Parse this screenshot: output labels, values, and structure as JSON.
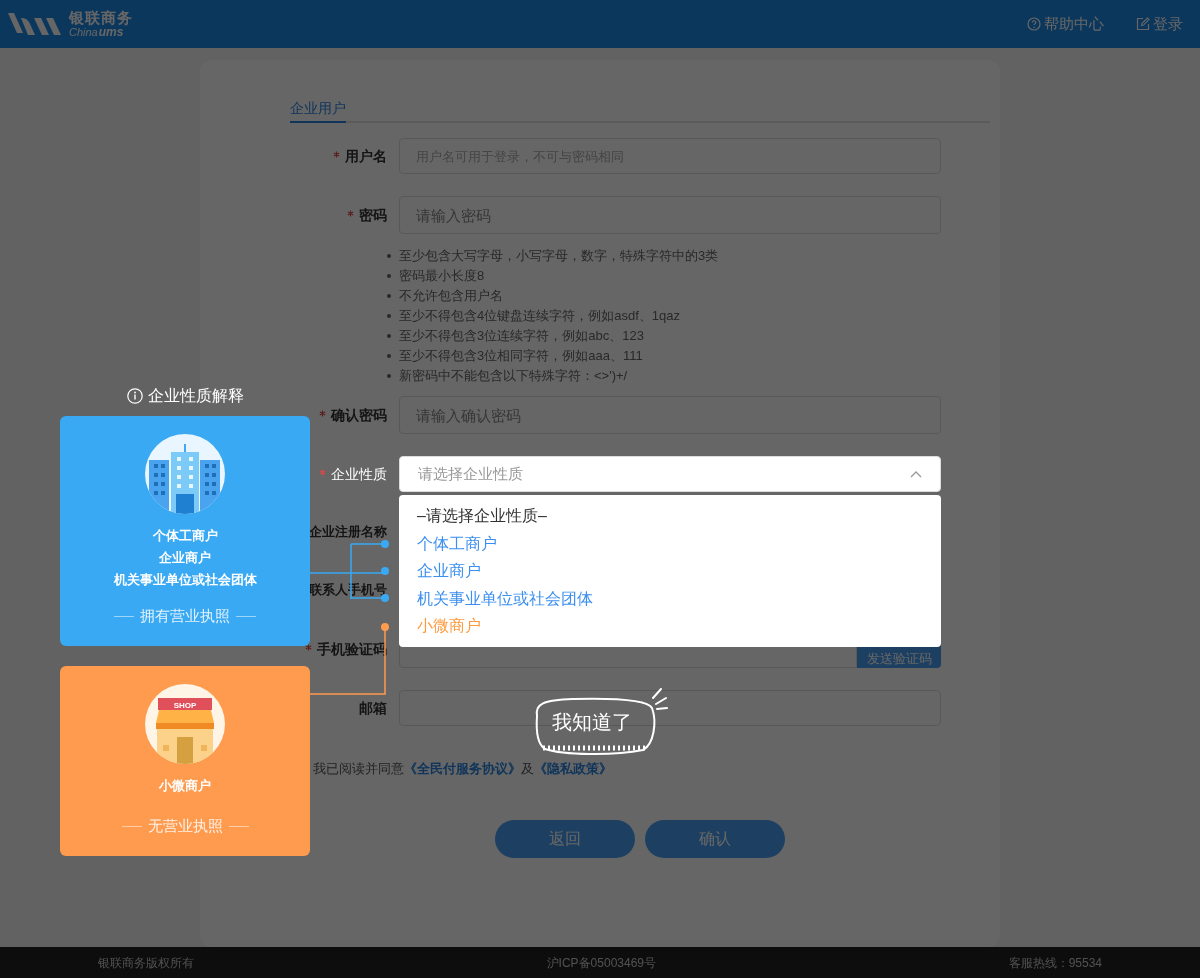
{
  "header": {
    "logo": {
      "name": "银联商务",
      "sub_1": "China",
      "sub_2": "ums"
    },
    "links": [
      {
        "label": "帮助中心",
        "kind": "help"
      },
      {
        "label": "登录",
        "kind": "login"
      }
    ]
  },
  "tabs": [
    {
      "label": "企业用户",
      "selected": true
    }
  ],
  "fields": [
    {
      "kind": "input",
      "label": "用户名",
      "required": true,
      "placeholder": "用户名可用于登录，不可与密码相同"
    },
    {
      "kind": "password",
      "label": "密码",
      "required": true,
      "placeholder": "请输入密码",
      "rules": [
        "至少包含大写字母，小写字母，数字，特殊字符中的3类",
        "密码最小长度8",
        "不允许包含用户名",
        "至少不得包含4位键盘连续字符，例如asdf、1qaz",
        "至少不得包含3位连续字符，例如abc、123",
        "至少不得包含3位相同字符，例如aaa、111",
        "新密码中不能包含以下特殊字符：<>')+/"
      ]
    },
    {
      "kind": "password",
      "label": "确认密码",
      "required": true,
      "placeholder": "请输入确认密码"
    },
    {
      "kind": "select",
      "label": "企业性质",
      "required": true,
      "placeholder": "请选择企业性质",
      "expanded": true,
      "options": [
        {
          "label": "–请选择企业性质–",
          "color": "#333333"
        },
        {
          "label": "个体工商户",
          "color": "#3b8ff0"
        },
        {
          "label": "企业商户",
          "color": "#3b8ff0"
        },
        {
          "label": "机关事业单位或社会团体",
          "color": "#3b8ff0"
        },
        {
          "label": "小微商户",
          "color": "#ff9a3c"
        }
      ]
    },
    {
      "kind": "hidden",
      "label": "企业注册名称",
      "required": false
    },
    {
      "kind": "hidden",
      "label": "联系人手机号",
      "required": false
    },
    {
      "kind": "code",
      "label": "手机验证码",
      "required": true,
      "button": "发送验证码"
    },
    {
      "kind": "input",
      "label": "邮箱",
      "required": false
    }
  ],
  "agreement": {
    "text": "我已阅读并同意",
    "joiner": "及",
    "links": [
      "《全民付服务协议》",
      "《隐私政策》"
    ]
  },
  "buttons": [
    "返回",
    "确认"
  ],
  "guide": {
    "title": "企业性质解释",
    "dismiss": "我知道了",
    "cards": [
      {
        "kind": "building",
        "color": "#3aa9f4",
        "lines": [
          "个体工商户",
          "企业商户",
          "机关事业单位或社会团体"
        ],
        "caption": "拥有营业执照"
      },
      {
        "kind": "shop",
        "color": "#ff9b4f",
        "sign": "SHOP",
        "lines": [
          "小微商户"
        ],
        "caption": "无营业执照"
      }
    ]
  },
  "footer": [
    "银联商务版权所有",
    "沪ICP备05003469号",
    "客服热线：95534"
  ]
}
